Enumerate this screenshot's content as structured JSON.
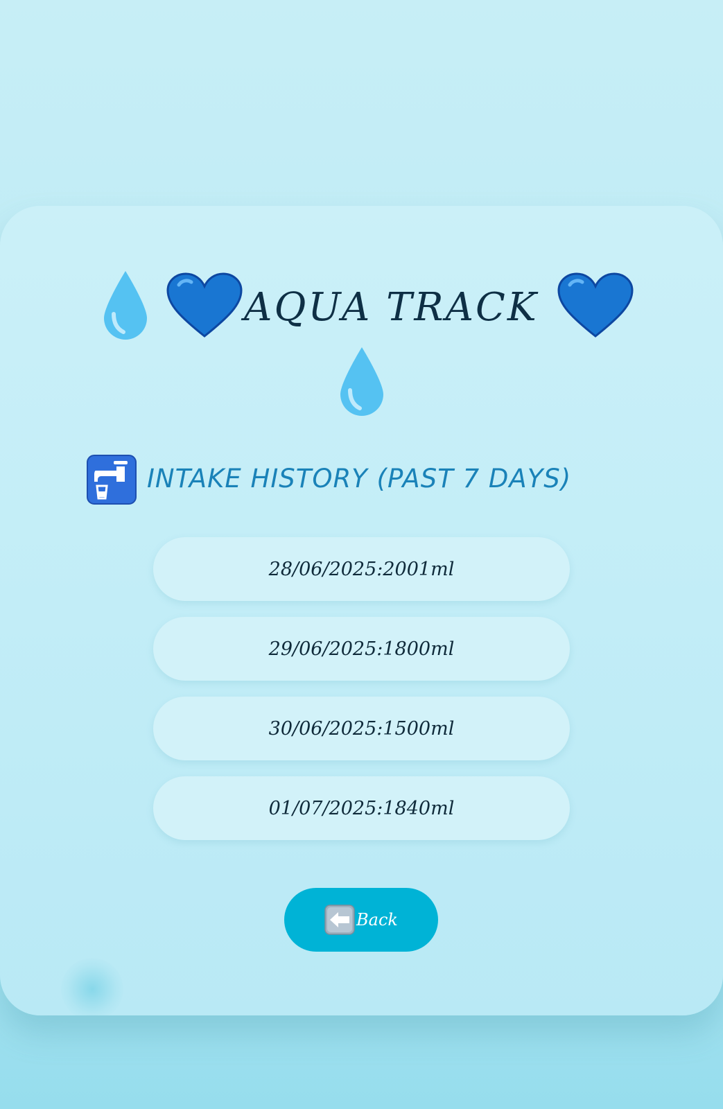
{
  "app": {
    "title": "AQUA TRACK",
    "title_icons": [
      "droplet-icon",
      "blue-heart-icon",
      "blue-heart-icon",
      "droplet-icon"
    ]
  },
  "history": {
    "heading": "INTAKE HISTORY (PAST 7 DAYS)",
    "heading_icon": "potable-water-icon",
    "entries": [
      "28/06/2025:2001ml",
      "29/06/2025:1800ml",
      "30/06/2025:1500ml",
      "01/07/2025:1840ml"
    ]
  },
  "actions": {
    "back_label": "Back",
    "back_icon": "left-arrow-icon"
  },
  "colors": {
    "background": "#c2edf7",
    "title": "#0e2f45",
    "heading": "#1a82b8",
    "entry_background": "#d2f2f9",
    "button": "#00b3d6",
    "heart": "#1976d2",
    "droplet": "#4fc3f7"
  }
}
